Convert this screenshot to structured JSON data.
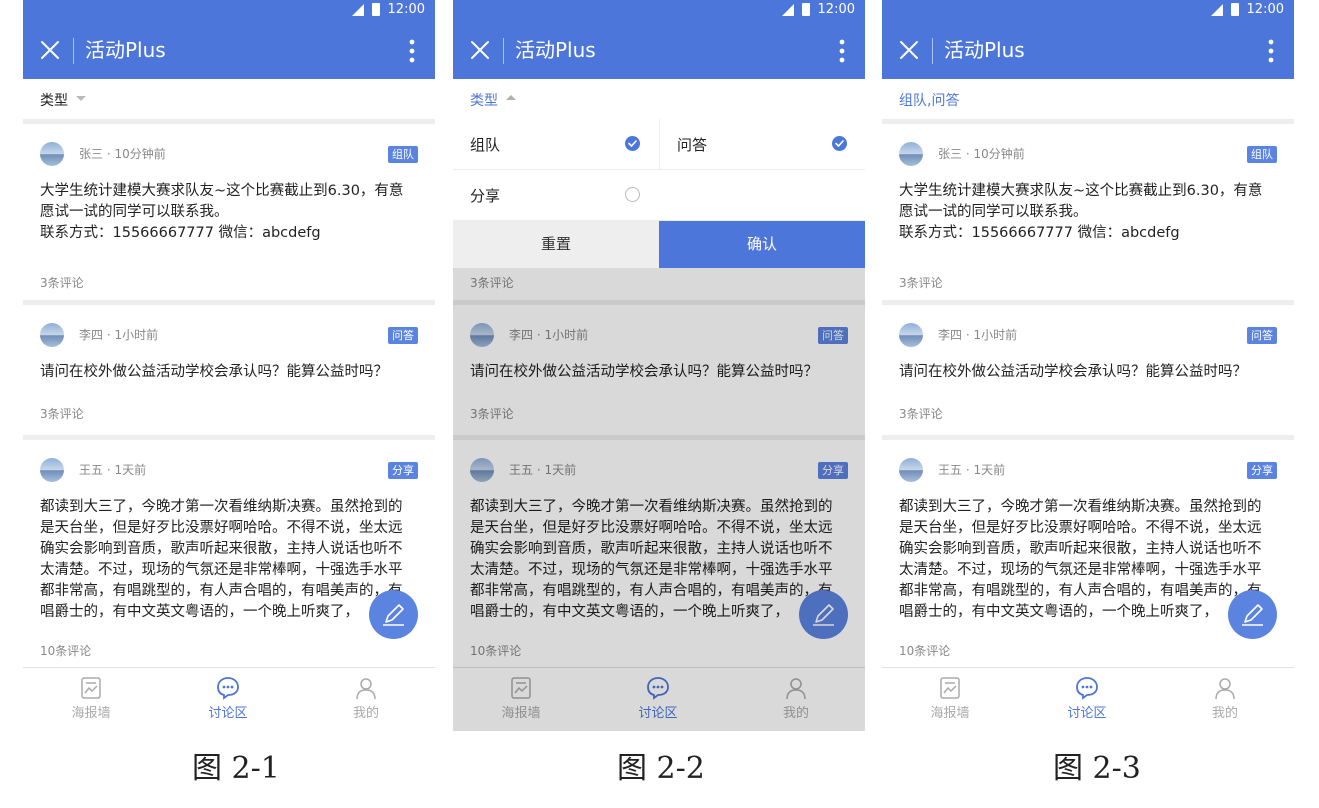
{
  "status_time": "12:00",
  "app_title": "活动Plus",
  "accent": "#4d76da",
  "posts": [
    {
      "author_time": "张三 · 10分钟前",
      "tag": "组队",
      "lines": [
        "大学生统计建模大赛求队友~这个比赛截止到6.30，有意",
        "愿试一试的同学可以联系我。",
        "联系方式：15566667777 微信：abcdefg"
      ],
      "comments": "3条评论"
    },
    {
      "author_time": "李四 · 1小时前",
      "tag": "问答",
      "lines": [
        "请问在校外做公益活动学校会承认吗？能算公益时吗？"
      ],
      "comments": "3条评论"
    },
    {
      "author_time": "王五 · 1天前",
      "tag": "分享",
      "lines": [
        "都读到大三了，今晚才第一次看维纳斯决赛。虽然抢到的",
        "是天台坐，但是好歹比没票好啊哈哈。不得不说，坐太远",
        "确实会影响到音质，歌声听起来很散，主持人说话也听不",
        "太清楚。不过，现场的气氛还是非常棒啊，十强选手水平",
        "都非常高，有唱跳型的，有人声合唱的，有唱美声的，有",
        "唱爵士的，有中文英文粤语的，一个晚上听爽了，"
      ],
      "comments": "10条评论"
    }
  ],
  "tabs": [
    {
      "label": "海报墙",
      "icon": "poster-wall-icon"
    },
    {
      "label": "讨论区",
      "icon": "chat-icon"
    },
    {
      "label": "我的",
      "icon": "person-icon"
    }
  ],
  "screens": [
    {
      "filter_label": "类型",
      "caption": "图 2-1"
    },
    {
      "filter_label": "类型",
      "caption": "图 2-2",
      "dropdown": {
        "options": [
          {
            "label": "组队",
            "checked": true
          },
          {
            "label": "问答",
            "checked": true
          },
          {
            "label": "分享",
            "checked": false
          }
        ],
        "reset_label": "重置",
        "confirm_label": "确认"
      }
    },
    {
      "filter_label": "组队,问答",
      "caption": "图 2-3"
    }
  ]
}
